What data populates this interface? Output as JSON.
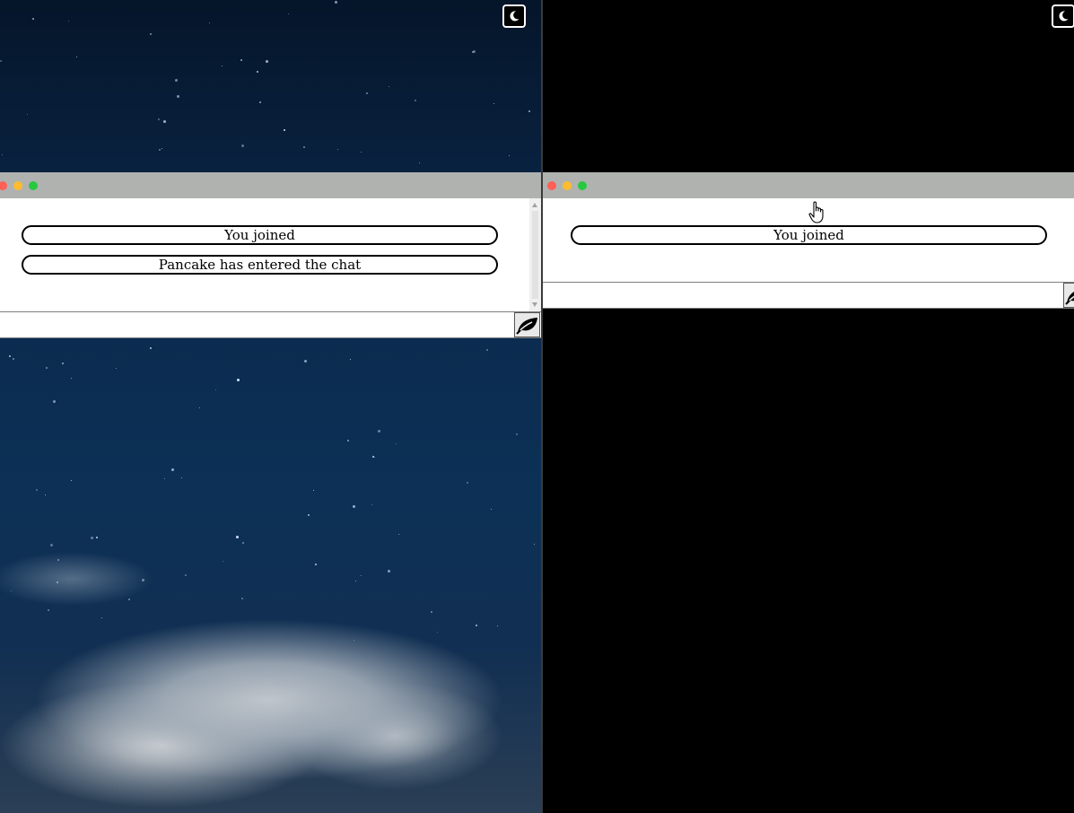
{
  "theme": {
    "titlebar_color": "#b0b2b0",
    "traffic_lights": [
      "#ff5f57",
      "#febc2e",
      "#28c840"
    ],
    "right_background": "#000000"
  },
  "left_pane": {
    "background": "night-sky-clouds",
    "toggle_icon": "moon-icon",
    "chat": {
      "messages": [
        {
          "text": "You joined"
        },
        {
          "text": "Pancake has entered the chat"
        }
      ],
      "input": {
        "value": "",
        "placeholder": ""
      },
      "send_icon": "leaf-icon"
    }
  },
  "right_pane": {
    "background": "black",
    "toggle_icon": "moon-icon",
    "chat": {
      "messages": [
        {
          "text": "You joined"
        }
      ],
      "input": {
        "value": "",
        "placeholder": ""
      },
      "send_icon": "leaf-icon"
    }
  }
}
